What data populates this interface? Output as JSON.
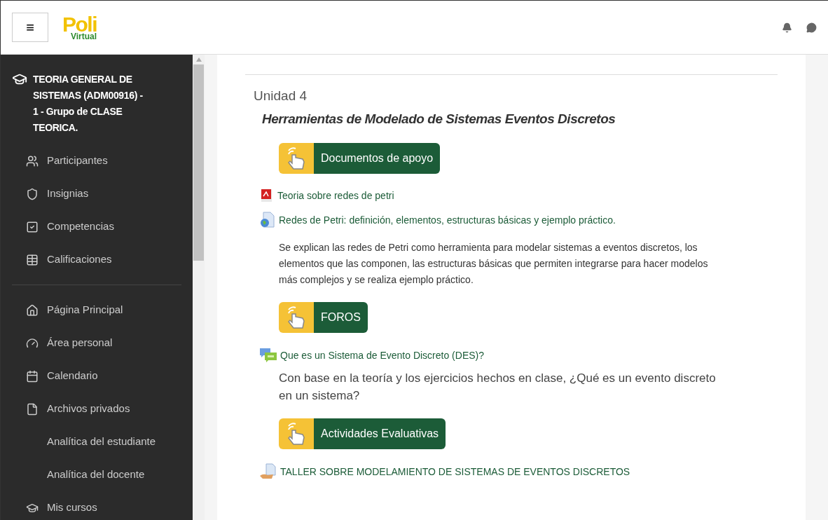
{
  "header": {
    "menu_icon": "≡",
    "logo": {
      "main": "Poli",
      "sub": "Virtual"
    }
  },
  "sidebar": {
    "course": "TEORIA GENERAL DE SISTEMAS (ADM00916) - 1 - Grupo de CLASE TEORICA.",
    "groups": [
      [
        "Participantes",
        "Insignias",
        "Competencias",
        "Calificaciones"
      ],
      [
        "Página Principal",
        "Área personal",
        "Calendario",
        "Archivos privados",
        "Analítica del estudiante",
        "Analítica del docente",
        "Mis cursos"
      ]
    ]
  },
  "section": {
    "title": "Unidad 4",
    "subtitle": "Herramientas de Modelado de Sistemas Eventos Discretos",
    "blocks": [
      {
        "kind": "banner",
        "label": "Documentos de apoyo"
      },
      {
        "kind": "pdf",
        "label": "Teoria sobre redes de petri"
      },
      {
        "kind": "web",
        "label": "Redes de Petri: definición, elementos, estructuras básicas y ejemplo práctico."
      },
      {
        "kind": "note",
        "text": "Se explican las redes de Petri como herramienta para modelar sistemas a eventos discretos, los elementos que las componen, las estructuras básicas que permiten integrarse para hacer modelos más complejos y se realiza ejemplo práctico."
      },
      {
        "kind": "banner",
        "label": "FOROS"
      },
      {
        "kind": "forum",
        "label": "Que es un Sistema de Evento Discreto (DES)?"
      },
      {
        "kind": "prompt",
        "text": "Con base en la teoría y los ejercicios hechos en clase, ¿Qué es un evento discreto en un sistema?"
      },
      {
        "kind": "banner",
        "label": "Actividades Evaluativas"
      },
      {
        "kind": "assign",
        "label": "TALLER SOBRE MODELAMIENTO DE SISTEMAS DE EVENTOS DISCRETOS"
      }
    ]
  }
}
